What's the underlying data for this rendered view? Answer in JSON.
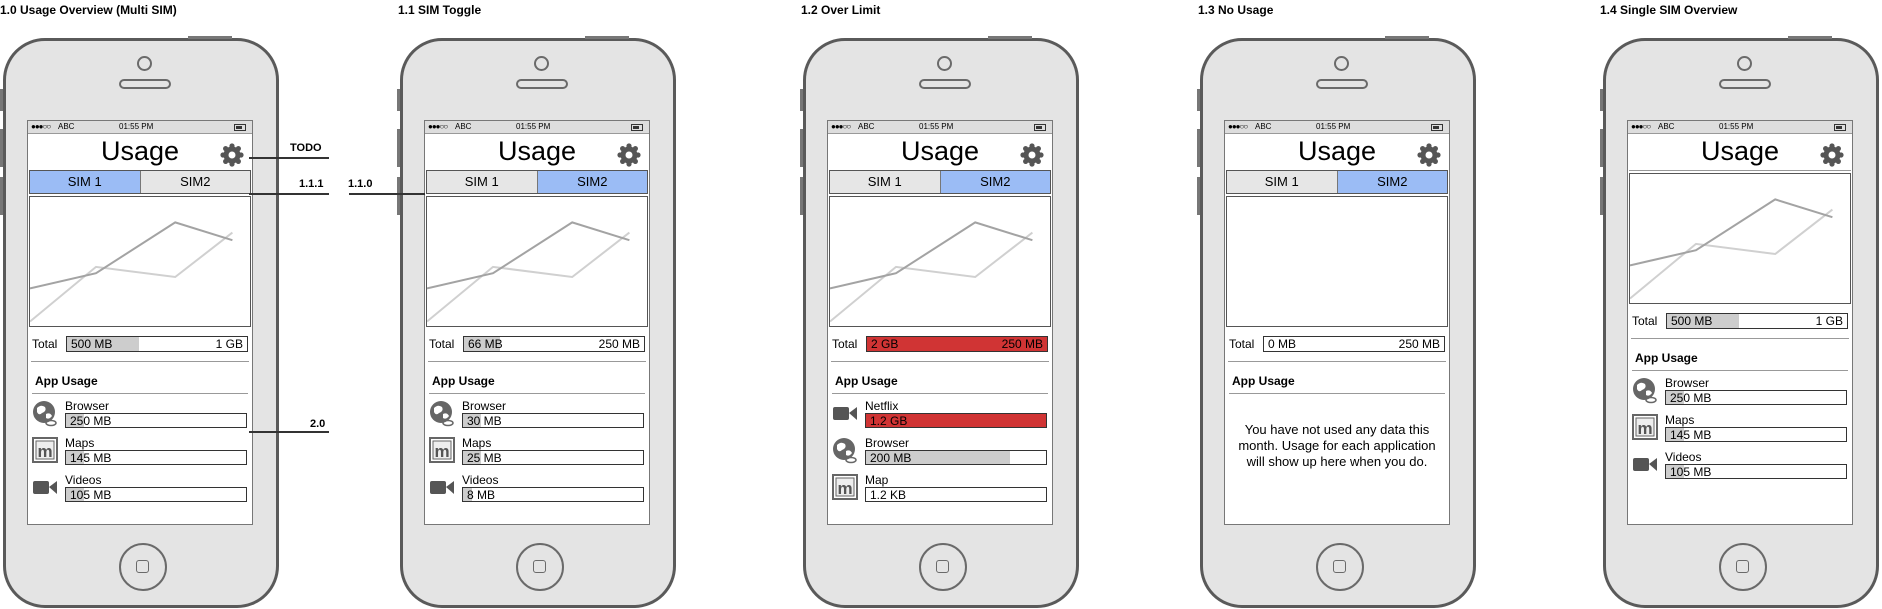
{
  "status_bar": {
    "signal": "●●●○○",
    "carrier": "ABC",
    "time": "01:55 PM"
  },
  "app_title": "Usage",
  "section_label": "App Usage",
  "total_label": "Total",
  "colors": {
    "tab_active": "#9bbcf5",
    "over_limit": "#d03434",
    "bar_fill": "#cdcdcd"
  },
  "chart_data": {
    "type": "line",
    "series": [
      {
        "values": [
          0.02,
          0.45,
          0.37,
          0.72
        ]
      },
      {
        "values": [
          0.28,
          0.4,
          0.8,
          0.66
        ]
      }
    ]
  },
  "screens": [
    {
      "title": "1.0 Usage Overview (Multi SIM)",
      "tabs": [
        "SIM 1",
        "SIM2"
      ],
      "active_tab": 0,
      "total": {
        "used": "500 MB",
        "limit": "1 GB",
        "fraction": 0.4,
        "over": false
      },
      "apps": [
        {
          "name": "Browser",
          "icon": "globe-icon",
          "value": "250 MB",
          "fraction": 0.1,
          "over": false
        },
        {
          "name": "Maps",
          "icon": "maps-icon",
          "value": "145 MB",
          "fraction": 0.1,
          "over": false
        },
        {
          "name": "Videos",
          "icon": "video-camera-icon",
          "value": "105 MB",
          "fraction": 0.1,
          "over": false
        }
      ]
    },
    {
      "title": "1.1 SIM Toggle",
      "tabs": [
        "SIM 1",
        "SIM2"
      ],
      "active_tab": 1,
      "total": {
        "used": "66 MB",
        "limit": "250 MB",
        "fraction": 0.2,
        "over": false
      },
      "apps": [
        {
          "name": "Browser",
          "icon": "globe-icon",
          "value": "30 MB",
          "fraction": 0.1,
          "over": false
        },
        {
          "name": "Maps",
          "icon": "maps-icon",
          "value": "25 MB",
          "fraction": 0.1,
          "over": false
        },
        {
          "name": "Videos",
          "icon": "video-camera-icon",
          "value": "8 MB",
          "fraction": 0.05,
          "over": false
        }
      ]
    },
    {
      "title": "1.2 Over Limit",
      "tabs": [
        "SIM 1",
        "SIM2"
      ],
      "active_tab": 1,
      "total": {
        "used": "2 GB",
        "limit": "250 MB",
        "fraction": 1,
        "over": true
      },
      "apps": [
        {
          "name": "Netflix",
          "icon": "video-camera-icon",
          "value": "1.2 GB",
          "fraction": 1,
          "over": true
        },
        {
          "name": "Browser",
          "icon": "globe-icon",
          "value": "200 MB",
          "fraction": 0.8,
          "over": false
        },
        {
          "name": "Map",
          "icon": "maps-icon",
          "value": "1.2 KB",
          "fraction": 0.0,
          "over": false
        }
      ]
    },
    {
      "title": "1.3 No Usage",
      "tabs": [
        "SIM 1",
        "SIM2"
      ],
      "active_tab": 1,
      "total": {
        "used": "0 MB",
        "limit": "250 MB",
        "fraction": 0,
        "over": false
      },
      "empty_message": "You have not used any data this month. Usage for each application will show up here when you do.",
      "apps": []
    },
    {
      "title": "1.4 Single SIM Overview",
      "tabs": [],
      "active_tab": -1,
      "total": {
        "used": "500 MB",
        "limit": "1 GB",
        "fraction": 0.4,
        "over": false
      },
      "apps": [
        {
          "name": "Browser",
          "icon": "globe-icon",
          "value": "250 MB",
          "fraction": 0.1,
          "over": false
        },
        {
          "name": "Maps",
          "icon": "maps-icon",
          "value": "145 MB",
          "fraction": 0.1,
          "over": false
        },
        {
          "name": "Videos",
          "icon": "video-camera-icon",
          "value": "105 MB",
          "fraction": 0.1,
          "over": false
        }
      ]
    }
  ],
  "annotations": [
    "TODO",
    "1.1.1",
    "1.1.0",
    "2.0"
  ]
}
